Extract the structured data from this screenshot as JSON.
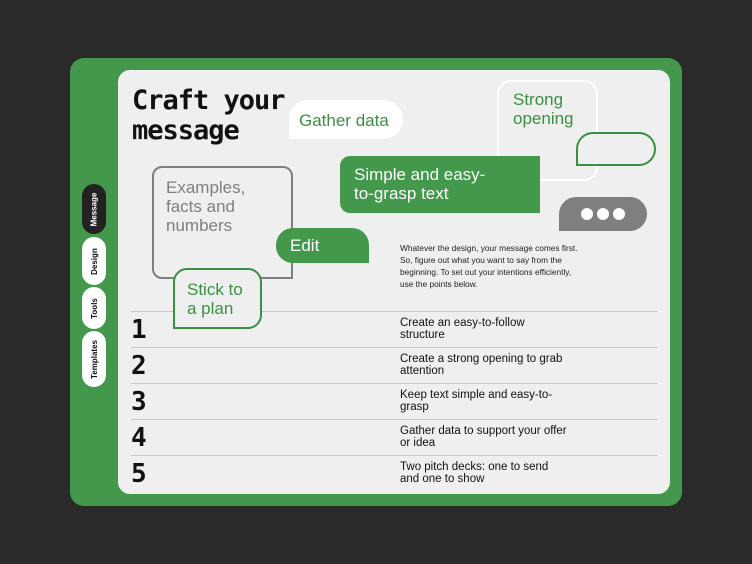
{
  "sidebar": {
    "tabs": [
      {
        "label": "Message",
        "active": true
      },
      {
        "label": "Design",
        "active": false
      },
      {
        "label": "Tools",
        "active": false
      },
      {
        "label": "Templates",
        "active": false
      }
    ]
  },
  "header": {
    "title_line1": "Craft your",
    "title_line2": "message"
  },
  "bubbles": {
    "gather": "Gather data",
    "strong_line1": "Strong",
    "strong_line2": "opening",
    "simple_line1": "Simple and easy-",
    "simple_line2": "to-grasp text",
    "examples_line1": "Examples,",
    "examples_line2": "facts and",
    "examples_line3": "numbers",
    "edit": "Edit",
    "stick_line1": "Stick to",
    "stick_line2": "a plan",
    "typing_icon": "ellipsis-icon"
  },
  "intro": "Whatever the design, your message comes first. So, figure out what you want to say from the beginning. To set out your intentions efficiently, use the points below.",
  "points": [
    {
      "num": "1",
      "text": "Create an easy-to-follow structure"
    },
    {
      "num": "2",
      "text": "Create a strong opening to grab attention"
    },
    {
      "num": "3",
      "text": "Keep text simple and easy-to-grasp"
    },
    {
      "num": "4",
      "text": "Gather data to support your offer or idea"
    },
    {
      "num": "5",
      "text": "Two pitch decks: one to send and one to show"
    }
  ],
  "colors": {
    "accent": "#43984c",
    "accent_text": "#3a8f43",
    "background": "#2a2a2a",
    "card": "#efefef",
    "gray": "#7f7f7f"
  }
}
